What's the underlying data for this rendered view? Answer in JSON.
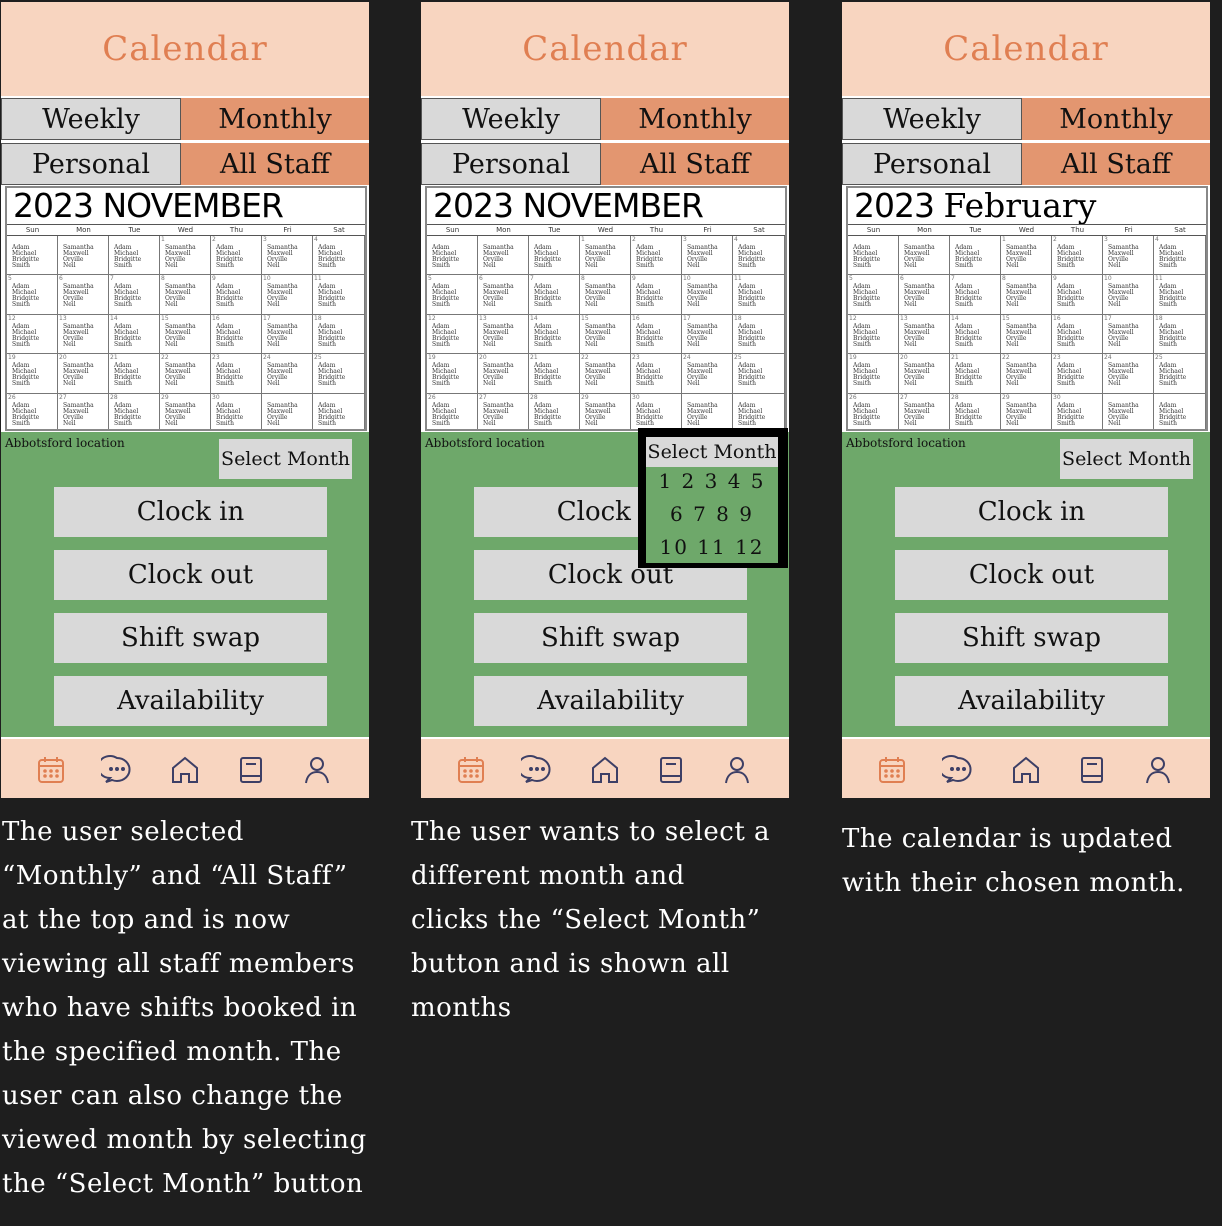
{
  "app": {
    "header_title": "Calendar",
    "tabs": {
      "weekly": "Weekly",
      "monthly": "Monthly",
      "personal": "Personal",
      "all_staff": "All Staff"
    },
    "location": "Abbotsford location",
    "select_month_label": "Select Month",
    "actions": [
      "Clock in",
      "Clock out",
      "Shift swap",
      "Availability"
    ],
    "nav_icons": [
      "calendar-icon",
      "chat-icon",
      "home-icon",
      "book-icon",
      "user-icon"
    ]
  },
  "calendar": {
    "weekdays": [
      "Sun",
      "Mon",
      "Tue",
      "Wed",
      "Thu",
      "Fri",
      "Sat"
    ],
    "weeks": [
      [
        "",
        "",
        "",
        "1",
        "2",
        "3",
        "4"
      ],
      [
        "5",
        "6",
        "7",
        "8",
        "9",
        "10",
        "11"
      ],
      [
        "12",
        "13",
        "14",
        "15",
        "16",
        "17",
        "18"
      ],
      [
        "19",
        "20",
        "21",
        "22",
        "23",
        "24",
        "25"
      ],
      [
        "26",
        "27",
        "28",
        "29",
        "30",
        "",
        ""
      ]
    ],
    "staff_group_a": "Adam\nMichael\nBridgitte\nSmith",
    "staff_group_b": "Samantha\nMaxwell\nOryille\nNeil"
  },
  "screens": [
    {
      "year": "2023",
      "month": "NOVEMBER",
      "caption": "The user selected “Monthly” and “All Staff” at the top and is now viewing all staff members who have shifts booked in the specified month. The user can also change the viewed month by selecting the “Select Month” button"
    },
    {
      "year": "2023",
      "month": "NOVEMBER",
      "caption": "The user wants to select a different month and clicks the “Select Month” button and is shown all months"
    },
    {
      "year": "2023",
      "month": "February",
      "caption": "The calendar is updated with their chosen month."
    }
  ],
  "month_picker": {
    "title": "Select Month",
    "rows": [
      "1 2 3 4 5",
      "6 7 8 9",
      "10 11 12"
    ]
  },
  "colors": {
    "header": "#f8d5c0",
    "accent": "#e07f52",
    "tab_active": "#e39670",
    "tab_inactive": "#d9d9d9",
    "panel": "#6ea86a",
    "background": "#1e1e1e"
  }
}
